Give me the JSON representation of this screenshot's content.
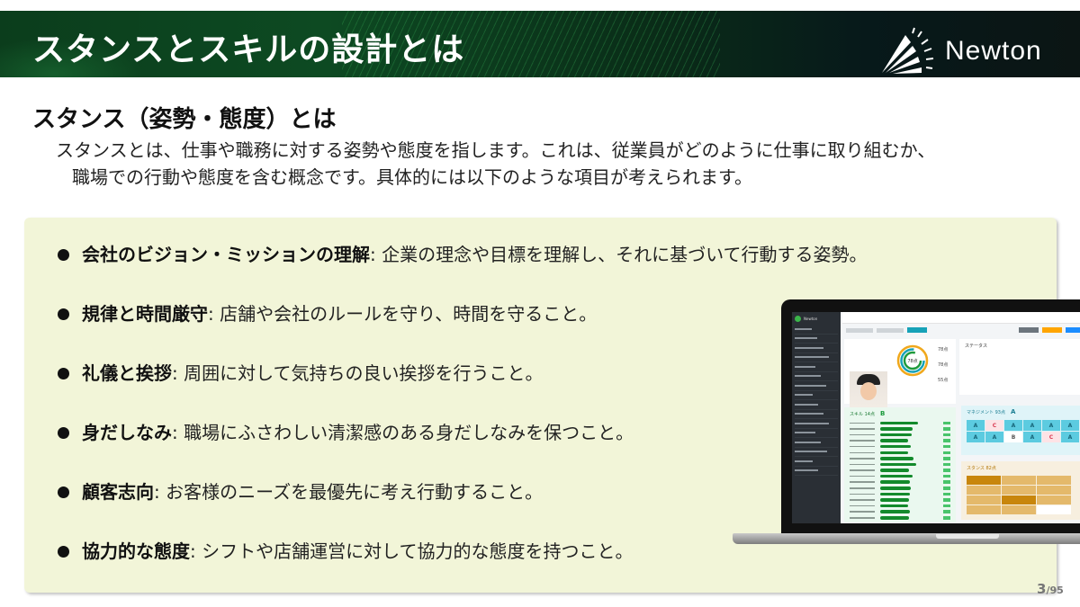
{
  "header": {
    "title": "スタンスとスキルの設計とは",
    "logo_text": "Newton"
  },
  "section": {
    "title": "スタンス（姿勢・態度）とは",
    "intro_line1": "スタンスとは、仕事や職務に対する姿勢や態度を指します。これは、従業員がどのように仕事に取り組むか、",
    "intro_line2": "職場での行動や態度を含む概念です。具体的には以下のような項目が考えられます。"
  },
  "bullets": [
    {
      "term": "会社のビジョン・ミッションの理解",
      "desc": ": 企業の理念や目標を理解し、それに基づいて行動する姿勢。"
    },
    {
      "term": "規律と時間厳守",
      "desc": ": 店舗や会社のルールを守り、時間を守ること。"
    },
    {
      "term": "礼儀と挨拶",
      "desc": ": 周囲に対して気持ちの良い挨拶を行うこと。"
    },
    {
      "term": "身だしなみ",
      "desc": ": 職場にふさわしい清潔感のある身だしなみを保つこと。"
    },
    {
      "term": "顧客志向",
      "desc": ": お客様のニーズを最優先に考え行動すること。"
    },
    {
      "term": "協力的な態度",
      "desc": ": シフトや店舗運営に対して協力的な態度を持つこと。"
    }
  ],
  "pagination": {
    "current": "3",
    "total": "/95"
  },
  "laptop_screen": {
    "app_name": "Newton",
    "gauge_score": "78点",
    "scores": [
      "78点",
      "78点",
      "55点"
    ],
    "status_title": "ステータス",
    "skill_title": "スキル 14点",
    "skill_grade": "B",
    "management_title": "マネジメント 93点",
    "management_grade": "A",
    "management_grades": [
      "A",
      "C",
      "A",
      "A",
      "A",
      "A",
      "A",
      "A",
      "B",
      "A",
      "C",
      "A"
    ],
    "stance_title": "スタンス 82点",
    "skill_bar_levels": [
      0.95,
      0.82,
      0.8,
      0.7,
      0.78,
      0.7,
      0.85,
      0.9,
      0.72,
      0.82,
      0.75,
      0.78,
      0.75,
      0.72,
      0.7,
      0.74,
      0.72
    ]
  }
}
